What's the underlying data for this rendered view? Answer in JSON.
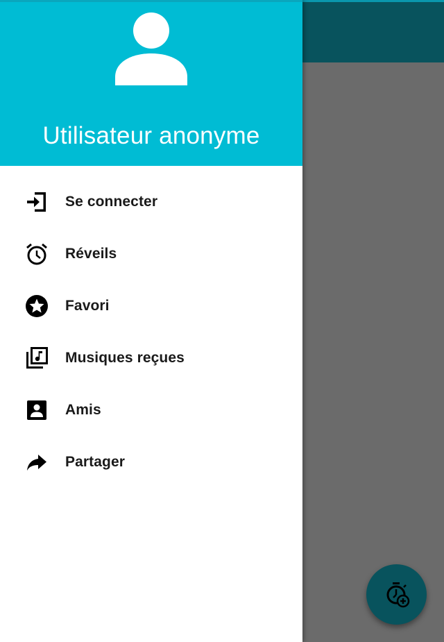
{
  "drawer": {
    "header": {
      "avatar_icon": "person-icon",
      "user_name": "Utilisateur anonyme",
      "background_color": "#00bcd4"
    },
    "items": [
      {
        "icon": "login-icon",
        "label": "Se connecter"
      },
      {
        "icon": "alarm-icon",
        "label": "Réveils"
      },
      {
        "icon": "star-icon",
        "label": "Favori"
      },
      {
        "icon": "music-library-icon",
        "label": "Musiques reçues"
      },
      {
        "icon": "contact-icon",
        "label": "Amis"
      },
      {
        "icon": "share-icon",
        "label": "Partager"
      }
    ]
  },
  "background_app": {
    "app_bar_color": "#08535d",
    "fab_icon": "add-alarm-timer-icon"
  }
}
